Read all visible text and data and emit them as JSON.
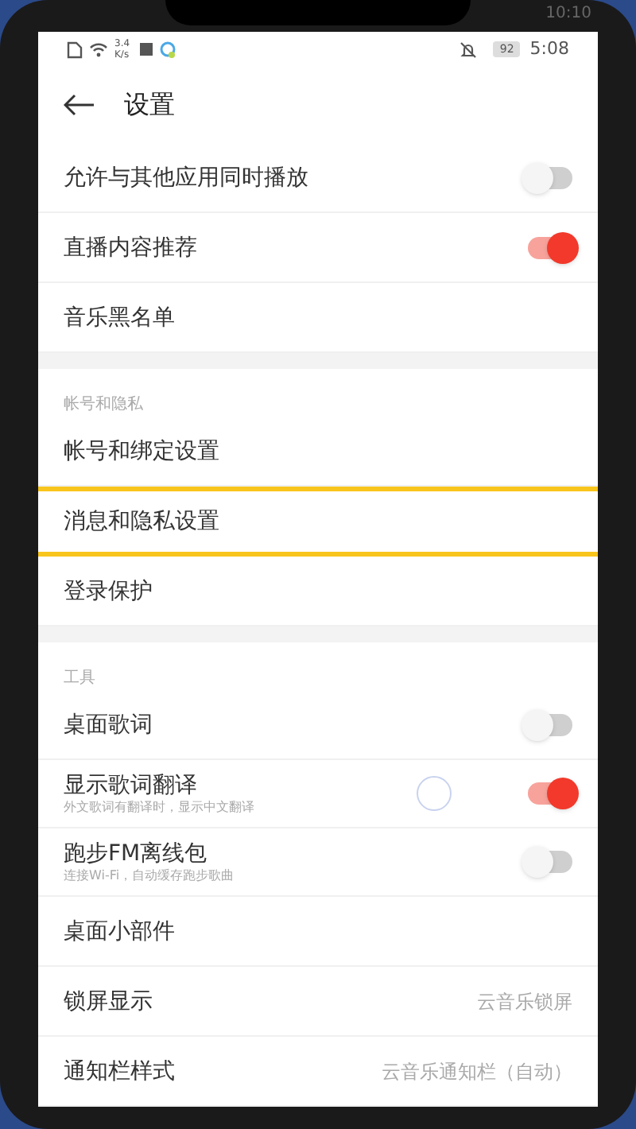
{
  "outer_status": {
    "time": "10:10"
  },
  "status_bar": {
    "speed": "3.4\nK/s",
    "battery": "92",
    "time": "5:08"
  },
  "header": {
    "title": "设置"
  },
  "sections": [
    {
      "items": [
        {
          "kind": "toggle",
          "label": "允许与其他应用同时播放",
          "on": false
        },
        {
          "kind": "toggle",
          "label": "直播内容推荐",
          "on": true
        },
        {
          "kind": "link",
          "label": "音乐黑名单"
        }
      ]
    },
    {
      "title": "帐号和隐私",
      "items": [
        {
          "kind": "link",
          "label": "帐号和绑定设置"
        },
        {
          "kind": "link",
          "label": "消息和隐私设置",
          "highlighted": true
        },
        {
          "kind": "link",
          "label": "登录保护"
        }
      ]
    },
    {
      "title": "工具",
      "items": [
        {
          "kind": "toggle",
          "label": "桌面歌词",
          "on": false
        },
        {
          "kind": "toggle",
          "label": "显示歌词翻译",
          "subtitle": "外文歌词有翻译时，显示中文翻译",
          "on": true,
          "touched": true
        },
        {
          "kind": "toggle",
          "label": "跑步FM离线包",
          "subtitle": "连接Wi-Fi，自动缓存跑步歌曲",
          "on": false
        },
        {
          "kind": "link",
          "label": "桌面小部件"
        },
        {
          "kind": "value",
          "label": "锁屏显示",
          "value": "云音乐锁屏"
        },
        {
          "kind": "value",
          "label": "通知栏样式",
          "value": "云音乐通知栏（自动）"
        }
      ]
    }
  ]
}
